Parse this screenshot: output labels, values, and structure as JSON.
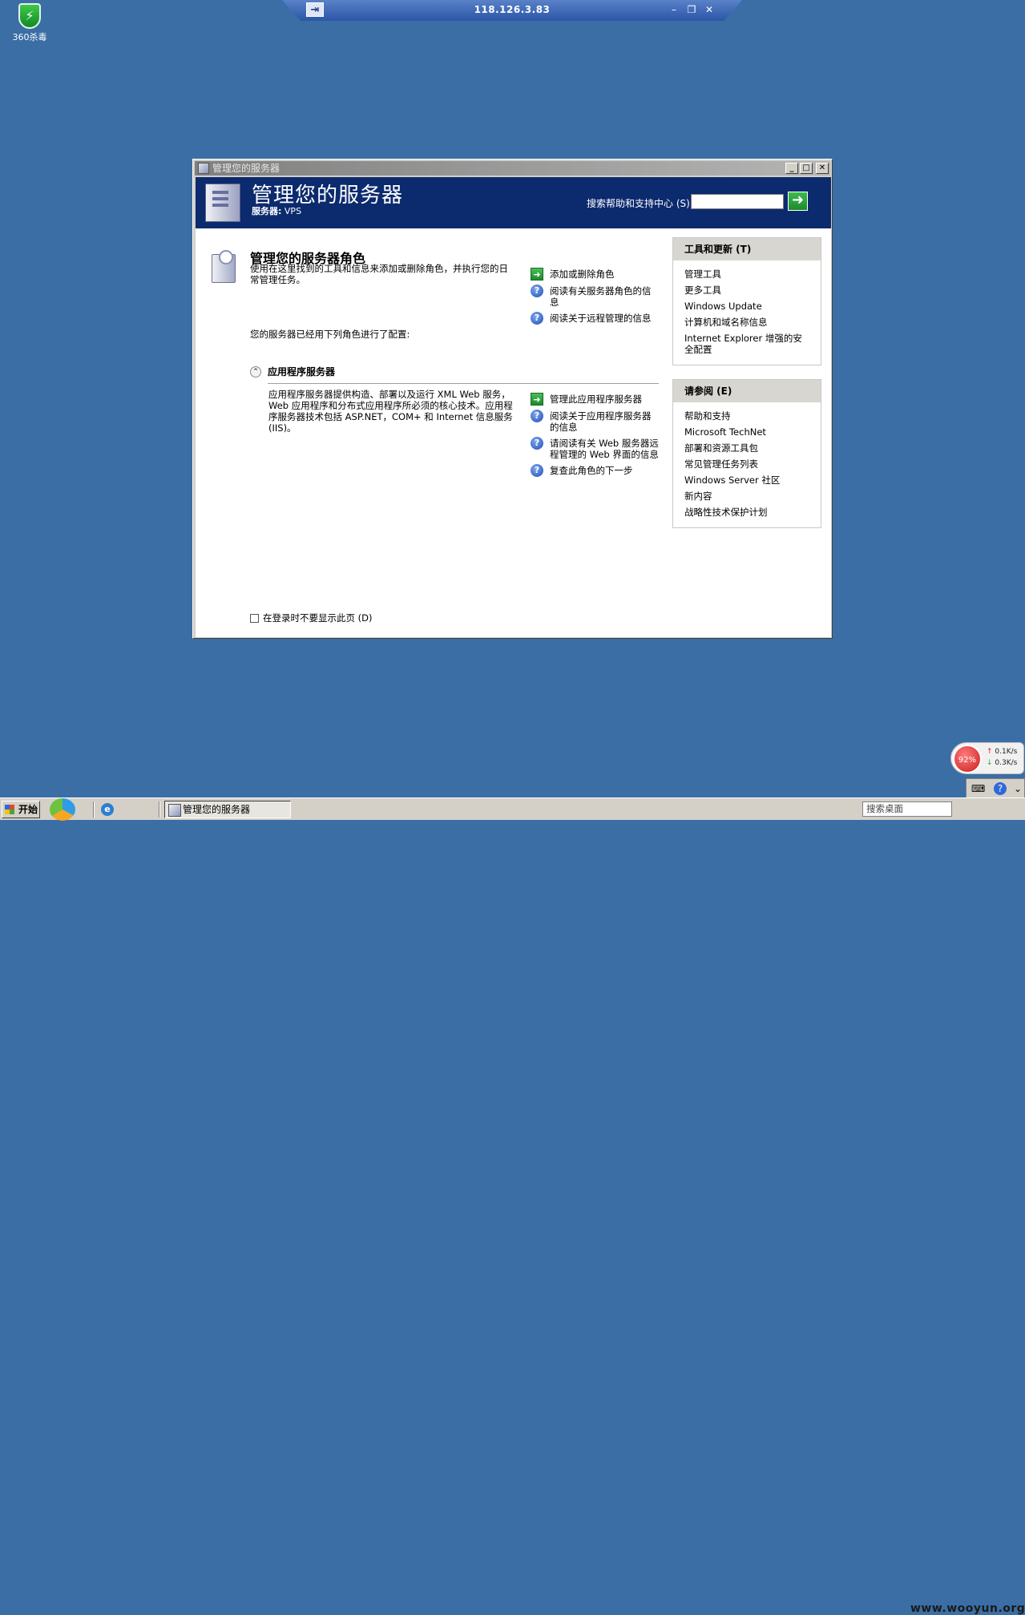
{
  "desktop": {
    "icon_360": {
      "label": "360杀毒",
      "glyph": "⚡"
    }
  },
  "rdp_bar": {
    "title": "118.126.3.83",
    "pin_glyph": "⇥",
    "min_glyph": "–",
    "restore_glyph": "❐",
    "close_glyph": "✕"
  },
  "window": {
    "title": "管理您的服务器",
    "btn_min": "_",
    "btn_max": "□",
    "btn_close": "✕",
    "banner": {
      "title": "管理您的服务器",
      "server_label": "服务器:",
      "server_value": "VPS",
      "search_label": "搜索帮助和支持中心 (S)",
      "search_value": "",
      "go_glyph": "➜"
    },
    "main": {
      "section_title": "管理您的服务器角色",
      "section_desc": "使用在这里找到的工具和信息来添加或删除角色，并执行您的日常管理任务。",
      "configured_text": "您的服务器已经用下列角色进行了配置:",
      "top_links": [
        {
          "icon": "arrow",
          "label": "添加或删除角色"
        },
        {
          "icon": "help",
          "label": "阅读有关服务器角色的信息"
        },
        {
          "icon": "help",
          "label": "阅读关于远程管理的信息"
        }
      ],
      "role": {
        "collapse_glyph": "⌃",
        "name": "应用程序服务器",
        "desc": "应用程序服务器提供构造、部署以及运行 XML Web 服务，Web 应用程序和分布式应用程序所必须的核心技术。应用程序服务器技术包括 ASP.NET，COM+ 和 Internet 信息服务(IIS)。",
        "links": [
          {
            "icon": "arrow",
            "label": "管理此应用程序服务器"
          },
          {
            "icon": "help",
            "label": "阅读关于应用程序服务器的信息"
          },
          {
            "icon": "help",
            "label": "请阅读有关 Web 服务器远程管理的 Web 界面的信息"
          },
          {
            "icon": "help",
            "label": "复查此角色的下一步"
          }
        ]
      },
      "startup_checkbox": "在登录时不要显示此页 (D)"
    },
    "sidebar": {
      "tools": {
        "title": "工具和更新 (T)",
        "items": [
          "管理工具",
          "更多工具",
          "Windows Update",
          "计算机和域名称信息",
          "Internet Explorer 增强的安全配置"
        ]
      },
      "see_also": {
        "title": "请参阅 (E)",
        "items": [
          "帮助和支持",
          "Microsoft TechNet",
          "部署和资源工具包",
          "常见管理任务列表",
          "Windows Server 社区",
          "新内容",
          "战略性技术保护计划"
        ]
      }
    }
  },
  "netmon": {
    "percent": "92%",
    "up": "0.1K/s",
    "down": "0.3K/s"
  },
  "taskbar": {
    "start": "开始",
    "ie_glyph": "e",
    "task_label": "管理您的服务器",
    "desk_search": "搜索桌面",
    "watermark": "www.wooyun.org"
  },
  "colors": {
    "desktop": "#3a6ea5",
    "banner": "#0c2a6e",
    "accent_green": "#1f8a2e"
  }
}
